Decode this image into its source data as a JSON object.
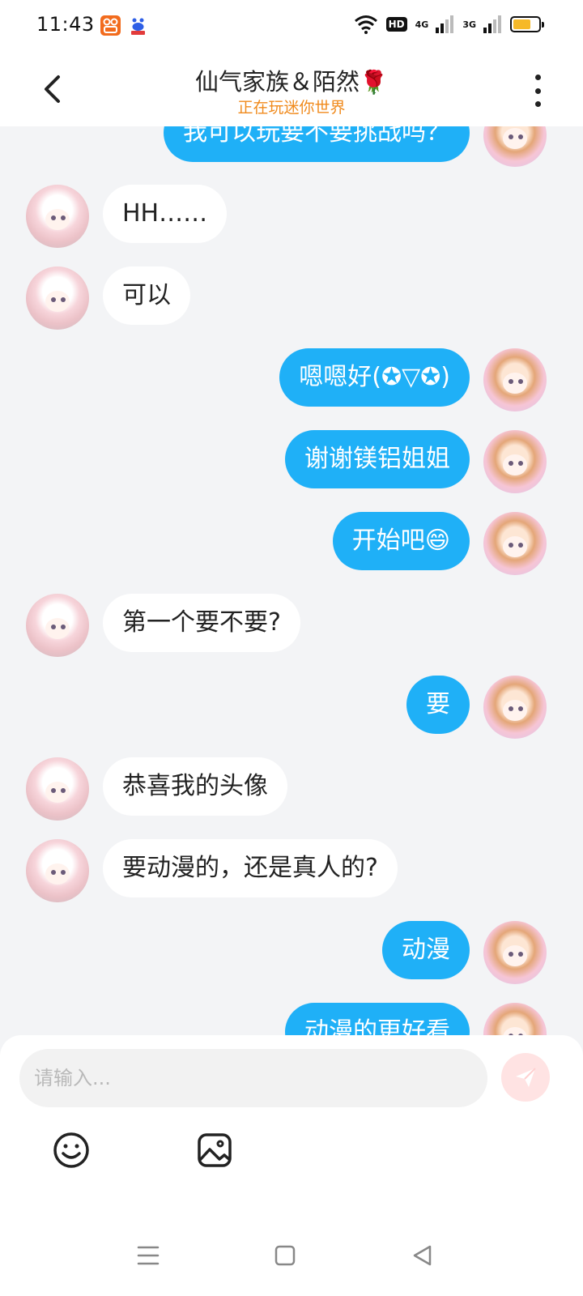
{
  "status_bar": {
    "time": "11:43",
    "hd_label": "HD",
    "network_1": "4G",
    "network_2": "3G",
    "battery_level": 0.7,
    "icons": [
      "app-icon-orange",
      "app-icon-baidu",
      "wifi-icon",
      "signal-icon",
      "battery-icon"
    ]
  },
  "header": {
    "title": "仙气家族＆陌然",
    "title_emoji": "🌹",
    "subtitle": "正在玩迷你世界",
    "subtitle_color": "#f08a1c"
  },
  "messages": [
    {
      "side": "me",
      "text": "我可以玩要不要挑战吗？"
    },
    {
      "side": "other",
      "text": "HH……"
    },
    {
      "side": "other",
      "text": "可以"
    },
    {
      "side": "me",
      "text": "嗯嗯好(✪▽✪)"
    },
    {
      "side": "me",
      "text": "谢谢镁铝姐姐"
    },
    {
      "side": "me",
      "text": "开始吧😄"
    },
    {
      "side": "other",
      "text": "第一个要不要?"
    },
    {
      "side": "me",
      "text": "要"
    },
    {
      "side": "other",
      "text": "恭喜我的头像"
    },
    {
      "side": "other",
      "text": "要动漫的，还是真人的?"
    },
    {
      "side": "me",
      "text": "动漫"
    },
    {
      "side": "me",
      "text": "动漫的更好看"
    }
  ],
  "input": {
    "placeholder": "请输入...",
    "value": ""
  },
  "colors": {
    "my_bubble": "#1fb0f7",
    "other_bubble": "#ffffff",
    "background": "#f3f4f6"
  }
}
